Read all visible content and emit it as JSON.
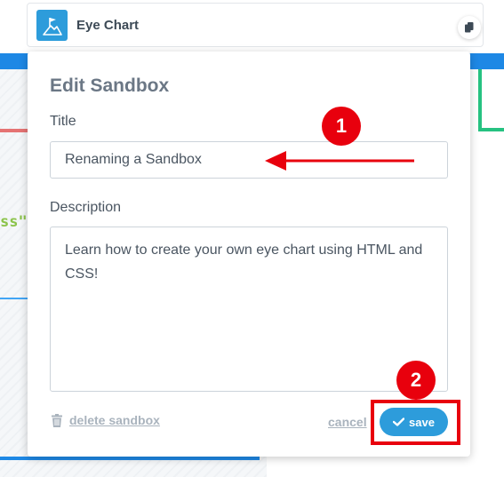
{
  "background": {
    "code_fragment": "ss\""
  },
  "header": {
    "title": "Eye Chart",
    "logo_icon": "flag-on-hill-icon",
    "copy_icon": "copy-icon"
  },
  "modal": {
    "title": "Edit Sandbox",
    "title_label": "Title",
    "title_value": "Renaming a Sandbox",
    "description_label": "Description",
    "description_value": "Learn how to create your own eye chart using HTML and CSS!",
    "delete_label": "delete sandbox",
    "delete_icon": "trash-icon",
    "cancel_label": "cancel",
    "save_label": "save",
    "save_icon": "checkmark-icon"
  },
  "annotations": {
    "step1": "1",
    "step2": "2",
    "color": "#e8000d"
  },
  "colors": {
    "accent": "#2d9cdb",
    "top_bar": "#1e88e5",
    "green": "#26c281"
  }
}
